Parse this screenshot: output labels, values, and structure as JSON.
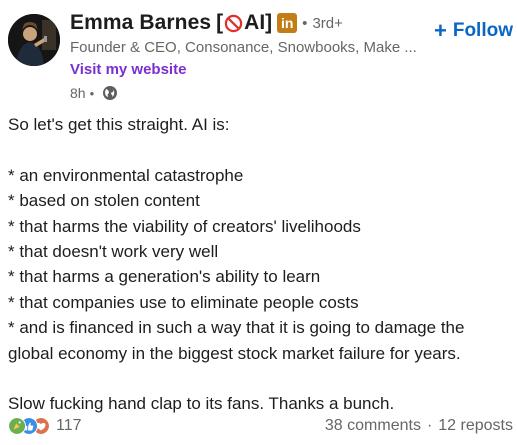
{
  "author": {
    "name": "Emma Barnes",
    "name_tag_open": "[",
    "name_tag_text": "AI]",
    "degree": "3rd+",
    "headline": "Founder & CEO, Consonance, Snowbooks, Make ...",
    "website_label": "Visit my website",
    "time": "8h",
    "separator": "•"
  },
  "follow": {
    "plus": "+",
    "label": "Follow"
  },
  "post": {
    "lines": [
      "So let's get this straight. AI is:",
      "",
      "* an environmental catastrophe",
      "* based on stolen content",
      "* that harms the viability of creators' livelihoods",
      "* that doesn't work very well",
      "* that harms a generation's ability to learn",
      "* that companies use to eliminate people costs",
      "* and is financed in such a way that it is going to damage the",
      "global economy in the biggest stock market failure for years.",
      "",
      "Slow fucking hand clap to its fans. Thanks a bunch."
    ]
  },
  "social": {
    "reaction_count": "117",
    "comments": "38 comments",
    "separator": "·",
    "reposts": "12 reposts"
  },
  "colors": {
    "follow_blue": "#0a66c2",
    "website_purple": "#7a2fd0",
    "premium_gold": "#c37d16",
    "muted_text": "#666666",
    "no_sign_red": "#e0302c"
  },
  "icons": {
    "no_sign": "prohibition-icon",
    "premium_badge": "linkedin-premium-icon",
    "globe": "globe-icon",
    "reactions": [
      "celebrate-icon",
      "like-icon",
      "love-icon"
    ]
  },
  "premium_badge_text": "in"
}
